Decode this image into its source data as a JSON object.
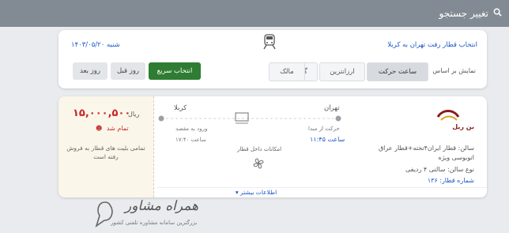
{
  "header": {
    "change_search_label": "تغییر جستجو",
    "search_icon": "search-icon"
  },
  "filter": {
    "route_title": "انتخاب قطار رفت تهران به کربلا",
    "date": "شنبه ۱۴۰۳/۰۵/۲۰",
    "sort_label": "نمایش بر اساس",
    "sort_options": [
      "ساعت حرکت",
      "ارزانترین",
      "گرانترین",
      "مالک"
    ],
    "quick_select": "انتخاب سریع",
    "prev_day": "روز قبل",
    "next_day": "روز بعد",
    "train_icon": "train-icon"
  },
  "train": {
    "company_name": "بن ریل",
    "origin": "تهران",
    "destination": "کربلا",
    "departure_label": "حرکت از مبدا",
    "departure_time": "ساعت ۱۱:۴۵",
    "arrival_label": "ورود به مقصد",
    "arrival_time": "ساعت ۱۷:۴۰",
    "amenities_label": "امکانات داخل قطار",
    "description": "سالن: قطار ایران۴تخته+قطار عراق اتوبوسی ویژه",
    "hall_type": "نوع سالن: سالنی ۴ ردیفی",
    "train_number": "شماره قطار: ۱۳۶",
    "more_info": "اطلاعات بیشتر",
    "price": "۱۵,۰۰۰,۵۰۰",
    "currency": "ریال",
    "sold_out": "تمام شد",
    "sold_out_message": "تمامی بلیت های قطار به فروش رفته است"
  },
  "watermark": {
    "title": "همراه مشاور",
    "subtitle": "بزرگترین سامانه مشاوره تلفنی کشور"
  },
  "colors": {
    "topbar": "#828b93",
    "primary_blue": "#1a56c9",
    "quick_green": "#2e7d32",
    "price_red": "#c62828"
  }
}
